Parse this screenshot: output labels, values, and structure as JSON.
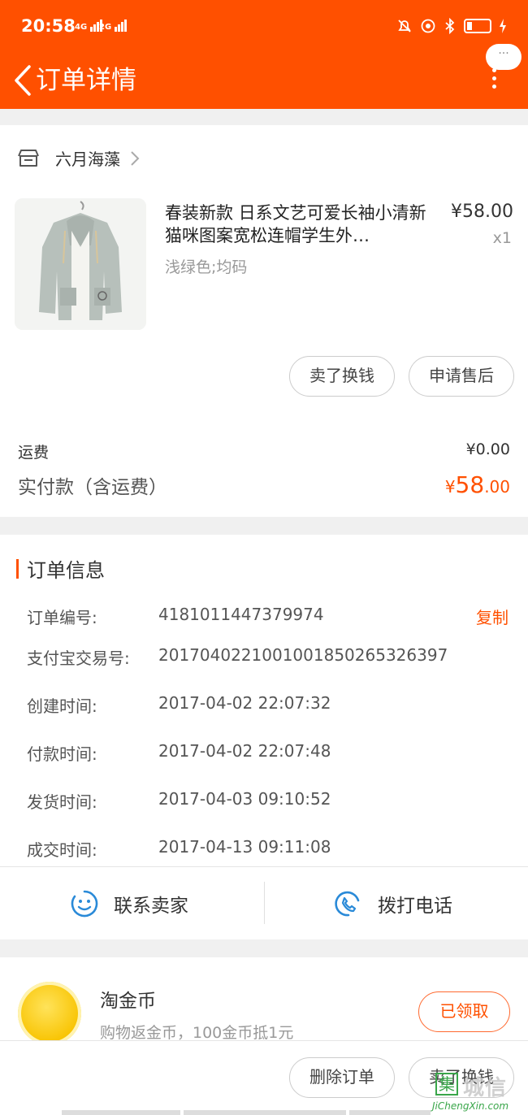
{
  "status": {
    "time": "20:58",
    "net1": "4G",
    "net2": "2G"
  },
  "nav": {
    "title": "订单详情",
    "bubble": "···"
  },
  "shop": {
    "name": "六月海藻"
  },
  "product": {
    "title": "春装新款 日系文艺可爱长袖小清新猫咪图案宽松连帽学生外…",
    "price": "¥58.00",
    "qty": "x1",
    "sku": "浅绿色;均码"
  },
  "item_actions": {
    "sell": "卖了换钱",
    "after_sale": "申请售后"
  },
  "summary": {
    "fee_label": "运费",
    "fee_value": "¥0.00",
    "paid_label": "实付款（含运费）",
    "paid_symbol": "¥",
    "paid_int": "58",
    "paid_dec": ".00"
  },
  "order_info": {
    "title": "订单信息",
    "copy": "复制",
    "rows": [
      {
        "label": "订单编号:",
        "value": "4181011447379974"
      },
      {
        "label": "支付宝交易号:",
        "value": "2017040221001001850265326397"
      },
      {
        "label": "创建时间:",
        "value": "2017-04-02 22:07:32"
      },
      {
        "label": "付款时间:",
        "value": "2017-04-02 22:07:48"
      },
      {
        "label": "发货时间:",
        "value": "2017-04-03 09:10:52"
      },
      {
        "label": "成交时间:",
        "value": "2017-04-13 09:11:08"
      }
    ],
    "contact_seller": "联系卖家",
    "call": "拨打电话"
  },
  "coins": {
    "title": "淘金币",
    "subtitle": "购物返金币，100金币抵1元",
    "button": "已领取"
  },
  "bottom": {
    "delete": "删除订单",
    "sell": "卖了换钱"
  },
  "watermark": {
    "glyph": "集",
    "text": "城信",
    "url": "JiChengXin.com"
  },
  "colors": {
    "brand": "#ff5000",
    "page_bg": "#f0f0f0",
    "link_blue": "#2a8ad8"
  }
}
